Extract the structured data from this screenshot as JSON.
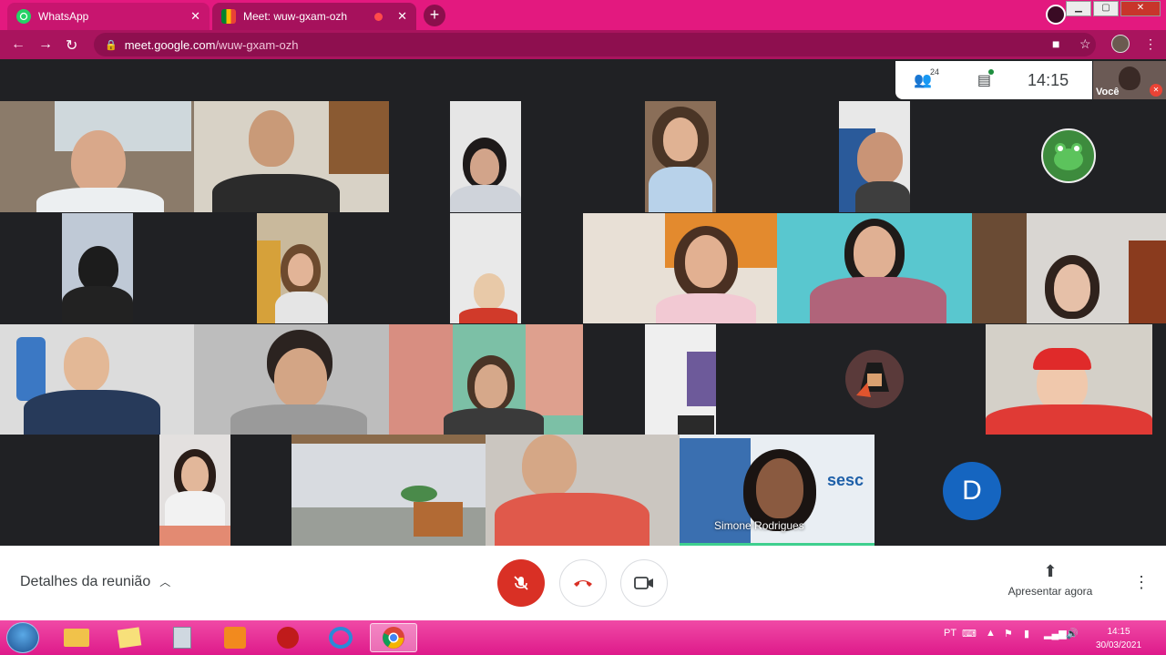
{
  "browser": {
    "tabs": [
      {
        "label": "WhatsApp",
        "icon": "whatsapp-icon"
      },
      {
        "label": "Meet: wuw-gxam-ozh",
        "icon": "google-meet-icon"
      }
    ],
    "url_host": "meet.google.com",
    "url_path": "/wuw-gxam-ozh"
  },
  "meet": {
    "participants_count": "24",
    "time": "14:15",
    "self_label": "Você",
    "pinned_name": "Simone Rodrigues",
    "avatar_letter": "D",
    "details_label": "Detalhes da reunião",
    "present_label": "Apresentar agora"
  },
  "taskbar": {
    "lang": "PT",
    "time": "14:15",
    "date": "30/03/2021"
  },
  "colors": {
    "browser_frame": "#e3197f",
    "meet_background": "#202124",
    "mute_red": "#d93025",
    "avatar_blue": "#1565c0"
  }
}
